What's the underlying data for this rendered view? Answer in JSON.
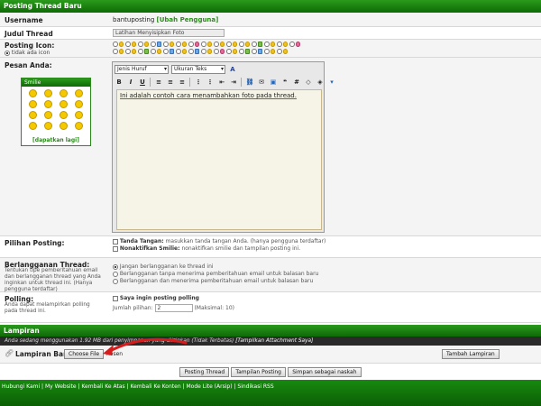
{
  "header": {
    "title": "Posting Thread Baru"
  },
  "username": {
    "label": "Username",
    "value": "bantuposting",
    "change_link": "[Ubah Pengguna]"
  },
  "title_field": {
    "label": "Judul Thread",
    "value": "Latihan Menyisipkan Foto"
  },
  "posting_icon": {
    "label": "Posting Icon:",
    "none_label": "tidak ada icon"
  },
  "message": {
    "label": "Pesan Anda:",
    "font_select": "Jenis Huruf",
    "size_select": "Ukuran Teks",
    "text": "Ini adalah contoh cara menambahkan foto pada thread."
  },
  "smilies": {
    "title": "Smilie",
    "more_link": "[dapatkan lagi]"
  },
  "toolbar": {
    "bold": "B",
    "italic": "I",
    "underline": "U"
  },
  "posting_options": {
    "label": "Pilihan Posting:",
    "signature_label": "Tanda Tangan:",
    "signature_desc": "masukkan tanda tangan Anda. (hanya pengguna terdaftar)",
    "smilie_label": "Nonaktifkan Smilie:",
    "smilie_desc": "nonaktifkan smilie dan tampilan posting ini."
  },
  "subscription": {
    "label": "Berlangganan Thread:",
    "description": "Tentukan tipe pemberitahuan email dan berlangganan thread yang Anda inginkan untuk thread ini. (Hanya pengguna terdaftar)",
    "options": [
      "Jangan berlangganan ke thread ini",
      "Berlangganan tanpa menerima pemberitahuan email untuk balasan baru",
      "Berlangganan dan menerima pemberitahuan email untuk balasan baru"
    ]
  },
  "polling": {
    "label": "Polling:",
    "description": "Anda dapat melampirkan polling pada thread ini.",
    "checkbox_label": "Saya ingin posting polling",
    "count_label": "Jumlah pilihan:",
    "count_value": "2",
    "max_label": "(Maksimal: 10)"
  },
  "attachments": {
    "section_title": "Lampiran",
    "usage_text": "Anda sedang menggunakan 1.92 MB dari penyimpanan yang diizinkan (Tidak Terbatas)",
    "show_link": "[Tampilkan Attachment Saya]",
    "label": "Lampiran Baru:",
    "choose_button": "Choose File",
    "file_status": "nosen",
    "add_button": "Tambah Lampiran"
  },
  "actions": {
    "post": "Posting Thread",
    "preview": "Tampilan Posting",
    "save_draft": "Simpan sebagai naskah"
  },
  "footer": {
    "links": [
      "Hubungi Kami",
      "My Website",
      "Kembali Ke Atas",
      "Kembali Ke Konten",
      "Mode Lite (Arsip)",
      "Sindikasi RSS"
    ],
    "separator": " | "
  },
  "colors": {
    "accent_green": "#0e6a06",
    "link_green": "#2a8a1a",
    "annotation_red": "#d61c1c"
  }
}
